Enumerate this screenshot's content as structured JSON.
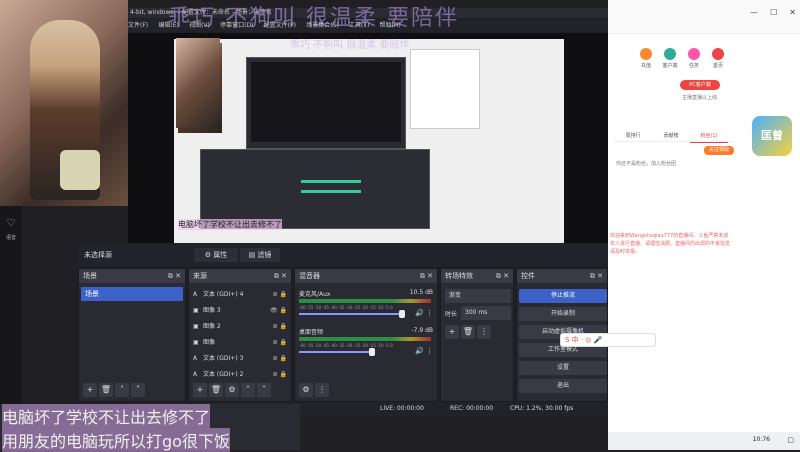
{
  "overlay": {
    "title": "乖巧 不狗叫 很温柔 要陪伴",
    "title_small": "乖巧 不狗叫 很温柔 要陪伴"
  },
  "window": {
    "title": "4-bit, windows) - 配置文件：未命名 - 场景：未命名",
    "menu": [
      "文件(F)",
      "编辑(E)",
      "视图(V)",
      "停靠窗口(D)",
      "配置文件(P)",
      "场景集合(S)",
      "工具(T)",
      "帮助(H)"
    ]
  },
  "preview": {
    "caption": "电脑坏了学校不让出去修不了"
  },
  "scene_bar": {
    "label": "未选择源",
    "properties": "属性",
    "filters": "滤镜"
  },
  "docks": {
    "scenes": {
      "title": "场景",
      "items": [
        "场景"
      ]
    },
    "sources": {
      "title": "来源",
      "items": [
        "文本 (GDI+) 4",
        "图像 3",
        "图像 2",
        "图像",
        "文本 (GDI+) 3",
        "文本 (GDI+) 2"
      ]
    },
    "mixer": {
      "title": "混音器",
      "channels": [
        {
          "name": "麦克风/Aux",
          "db": "10.5 dB"
        },
        {
          "name": "桌面音频",
          "db": "-7.9 dB"
        }
      ],
      "scale": "-60 -55 -50 -45 -40 -35 -30 -25 -20 -15 -10 -5 0"
    },
    "transitions": {
      "title": "转场特效",
      "selected": "渐变",
      "duration_label": "时长",
      "duration": "300 ms"
    },
    "controls": {
      "title": "控件",
      "buttons": [
        "停止推流",
        "开始录制",
        "启动虚拟摄像机",
        "工作室模式",
        "设置",
        "退出"
      ]
    }
  },
  "status": {
    "live": "LIVE: 00:00:00",
    "rec": "REC: 00:00:00",
    "cpu": "CPU: 1.2%, 30.00 fps"
  },
  "caption": {
    "line1": "电脑坏了学校不让出去修不了",
    "line2": "用朋友的电脑玩所以打go很下饭"
  },
  "left_bar": {
    "label": "语音"
  },
  "browser": {
    "toolbar": [
      "充值",
      "客户端",
      "任务",
      "首页"
    ],
    "pc_button": "PC客户端",
    "side_text": "主播直播以上线",
    "tabs": [
      "周排行",
      "贡献榜",
      "粉丝(1)"
    ],
    "badge": "匡曾",
    "fb_label": "关注领取",
    "fans_text": "你还不是粉丝，加入粉丝团",
    "chat": "欢迎来到Wangshuqiao777的直播间，斗鱼严禁未成年人进行直播，请理性消费。直播间内出现的不良信息请及时举报。",
    "time": "10:76",
    "sogou": "S 中 · ◎ 🎤"
  },
  "colors": {
    "accent": "#3c62c9",
    "overlay": "#bea0f0",
    "live_red": "#e44"
  }
}
